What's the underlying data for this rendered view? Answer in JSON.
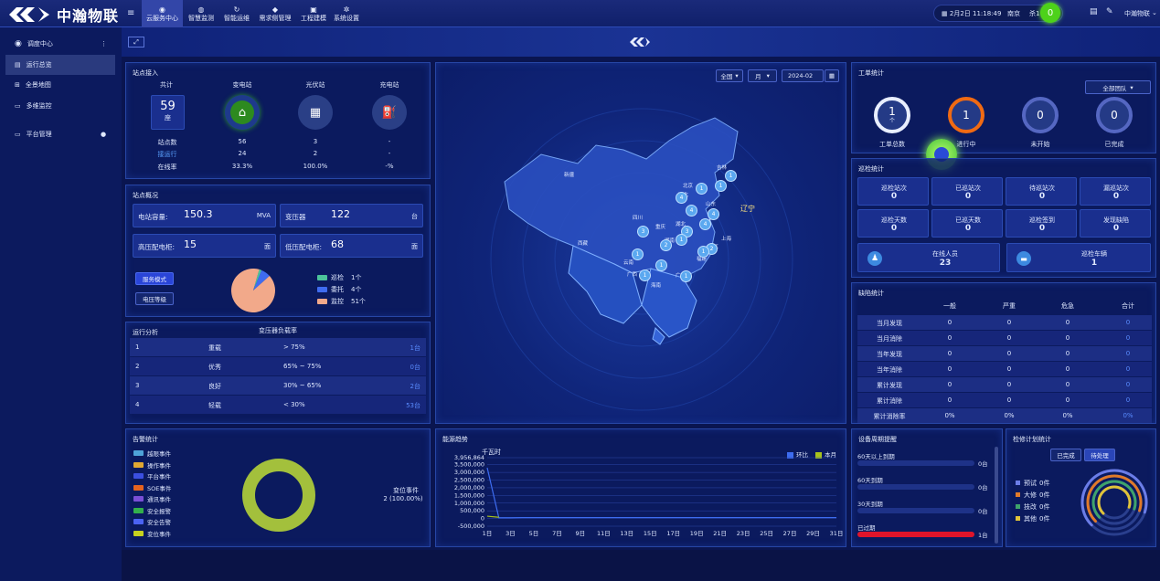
{
  "brand": {
    "name": "中瀚物联"
  },
  "nav": {
    "tabs": [
      {
        "label": "云服务中心",
        "icon": "◉"
      },
      {
        "label": "智慧监测",
        "icon": "◍"
      },
      {
        "label": "智能运维",
        "icon": "↻"
      },
      {
        "label": "需求侧管理",
        "icon": "◆"
      },
      {
        "label": "工程建模",
        "icon": "▣"
      },
      {
        "label": "系统设置",
        "icon": "✲"
      }
    ],
    "datetime": "2月2日 11:18:49",
    "city": "南京",
    "weather_prefix": "杀1",
    "notif_count": "0",
    "user": "中瀚物联"
  },
  "sidebar": {
    "items": [
      {
        "label": "调度中心"
      },
      {
        "label": "运行总览"
      },
      {
        "label": "全景地图"
      },
      {
        "label": "多维监控"
      },
      {
        "label": "平台管理"
      }
    ]
  },
  "station_access": {
    "title": "站点接入",
    "total_label": "共计",
    "total_value": "59",
    "total_unit": "座",
    "cols": [
      "变电站",
      "光伏站",
      "充电站"
    ],
    "rows": [
      {
        "label": "站点数",
        "values": [
          "56",
          "3",
          "-"
        ]
      },
      {
        "label": "接运行",
        "values": [
          "24",
          "2",
          "-"
        ]
      },
      {
        "label": "在线率",
        "values": [
          "33.3%",
          "100.0%",
          "-%"
        ]
      }
    ]
  },
  "station_overview": {
    "title": "站点概况",
    "cards": [
      {
        "label": "电站容量:",
        "value": "150.3",
        "unit": "MVA"
      },
      {
        "label": "变压器",
        "value": "122",
        "unit": "台"
      },
      {
        "label": "高压配电柜:",
        "value": "15",
        "unit": "面"
      },
      {
        "label": "低压配电柜:",
        "value": "68",
        "unit": "面"
      }
    ],
    "btn_service": "服务模式",
    "btn_voltage": "电压等级",
    "pie": [
      {
        "name": "巡检",
        "count": "1个",
        "value": 1,
        "color": "#4cc39a"
      },
      {
        "name": "委托",
        "count": "4个",
        "value": 4,
        "color": "#3f6cf0"
      },
      {
        "name": "监控",
        "count": "51个",
        "value": 51,
        "color": "#f2a98a"
      }
    ]
  },
  "run_analysis": {
    "title": "运行分析",
    "subtitle": "变压器负载率",
    "rows": [
      {
        "idx": "1",
        "name": "重载",
        "range": "> 75%",
        "count": "1台"
      },
      {
        "idx": "2",
        "name": "优秀",
        "range": "65% ~ 75%",
        "count": "0台"
      },
      {
        "idx": "3",
        "name": "良好",
        "range": "30% ~ 65%",
        "count": "2台"
      },
      {
        "idx": "4",
        "name": "轻载",
        "range": "< 30%",
        "count": "53台"
      }
    ]
  },
  "map": {
    "filter_region": "全国",
    "filter_period": "月",
    "filter_date": "2024-02",
    "highlight": "辽宁",
    "labels": [
      "新疆",
      "西藏",
      "广西",
      "海南",
      "云南",
      "吉林",
      "北京",
      "河北",
      "山东",
      "江苏",
      "上海",
      "浙江",
      "福建",
      "广东",
      "湖南",
      "湖北",
      "四川",
      "重庆"
    ],
    "clusters": [
      "1",
      "1",
      "4",
      "4",
      "4",
      "4",
      "3",
      "3",
      "2",
      "2",
      "1",
      "1",
      "1",
      "1",
      "1",
      "1",
      "1"
    ]
  },
  "work_orders": {
    "title": "工单统计",
    "filter": "全部团队",
    "items": [
      {
        "label": "工单总数",
        "value": "1",
        "sub": "个",
        "color": "#e8eeff"
      },
      {
        "label": "进行中",
        "value": "1",
        "sub": "",
        "color": "#f06a13"
      },
      {
        "label": "未开始",
        "value": "0",
        "sub": "",
        "color": "#5567c2"
      },
      {
        "label": "已完成",
        "value": "0",
        "sub": "",
        "color": "#5567c2"
      }
    ]
  },
  "patrol": {
    "title": "巡检统计",
    "cells": [
      {
        "label": "巡检站次",
        "value": "0"
      },
      {
        "label": "已巡站次",
        "value": "0"
      },
      {
        "label": "待巡站次",
        "value": "0"
      },
      {
        "label": "漏巡站次",
        "value": "0"
      },
      {
        "label": "巡检天数",
        "value": "0"
      },
      {
        "label": "已巡天数",
        "value": "0"
      },
      {
        "label": "巡检签到",
        "value": "0"
      },
      {
        "label": "发现缺陷",
        "value": "0"
      }
    ],
    "online_label": "在线人员",
    "online_value": "23",
    "vehicle_label": "巡检车辆",
    "vehicle_value": "1"
  },
  "defects": {
    "title": "缺陷统计",
    "headers": [
      "一般",
      "严重",
      "危急",
      "合计"
    ],
    "rows": [
      {
        "label": "当月发现",
        "values": [
          "0",
          "0",
          "0",
          "0"
        ]
      },
      {
        "label": "当月消除",
        "values": [
          "0",
          "0",
          "0",
          "0"
        ]
      },
      {
        "label": "当年发现",
        "values": [
          "0",
          "0",
          "0",
          "0"
        ]
      },
      {
        "label": "当年消除",
        "values": [
          "0",
          "0",
          "0",
          "0"
        ]
      },
      {
        "label": "累计发现",
        "values": [
          "0",
          "0",
          "0",
          "0"
        ]
      },
      {
        "label": "累计消除",
        "values": [
          "0",
          "0",
          "0",
          "0"
        ]
      },
      {
        "label": "累计消除率",
        "values": [
          "0%",
          "0%",
          "0%",
          "0%"
        ]
      }
    ]
  },
  "alarms": {
    "title": "告警统计",
    "legend": [
      {
        "name": "越限事件",
        "color": "#4ea3d8"
      },
      {
        "name": "操作事件",
        "color": "#e1a832"
      },
      {
        "name": "平台事件",
        "color": "#3b4fe0"
      },
      {
        "name": "SOE事件",
        "color": "#e5631f"
      },
      {
        "name": "通讯事件",
        "color": "#7a4fd6"
      },
      {
        "name": "安全报警",
        "color": "#33b04c"
      },
      {
        "name": "安全告警",
        "color": "#4b63f2"
      },
      {
        "name": "变位事件",
        "color": "#c6d11f"
      }
    ],
    "summary_label": "变位事件",
    "summary_value": "2 (100.00%)",
    "ring_color": "#a3c03c"
  },
  "energy": {
    "title": "能源趋势",
    "unit": "千瓦时",
    "legend": [
      {
        "name": "环比",
        "color": "#3d6cf0"
      },
      {
        "name": "本月",
        "color": "#a8c21c"
      }
    ]
  },
  "chart_data": {
    "type": "line",
    "ylabel": "千瓦时",
    "ylim": [
      -500000,
      3956864
    ],
    "yticks": [
      "3,956,864",
      "3,500,000",
      "3,000,000",
      "2,500,000",
      "2,000,000",
      "1,500,000",
      "1,000,000",
      "500,000",
      "0",
      "-500,000"
    ],
    "ytick_values": [
      3956864,
      3500000,
      3000000,
      2500000,
      2000000,
      1500000,
      1000000,
      500000,
      0,
      -500000
    ],
    "categories": [
      "1日",
      "3日",
      "5日",
      "7日",
      "9日",
      "11日",
      "13日",
      "15日",
      "17日",
      "19日",
      "21日",
      "23日",
      "25日",
      "27日",
      "29日",
      "31日"
    ],
    "x": [
      1,
      2,
      3,
      4,
      5,
      6,
      7,
      8,
      9,
      10,
      11,
      12,
      13,
      14,
      15,
      16,
      17,
      18,
      19,
      20,
      21,
      22,
      23,
      24,
      25,
      26,
      27,
      28,
      29,
      30,
      31
    ],
    "series": [
      {
        "name": "环比",
        "color": "#3d6cf0",
        "values": [
          3300000,
          50000,
          50000,
          60000,
          60000,
          60000,
          60000,
          60000,
          60000,
          60000,
          60000,
          60000,
          60000,
          60000,
          60000,
          60000,
          60000,
          60000,
          60000,
          60000,
          60000,
          60000,
          60000,
          60000,
          60000,
          60000,
          60000,
          60000,
          60000,
          60000,
          60000
        ]
      },
      {
        "name": "本月",
        "color": "#a8c21c",
        "values": [
          150000,
          80000
        ]
      }
    ]
  },
  "expiry": {
    "title": "设备周期提醒",
    "rows": [
      {
        "label": "60天以上到期",
        "count": "0台",
        "fill": 0
      },
      {
        "label": "60天到期",
        "count": "0台",
        "fill": 0
      },
      {
        "label": "30天到期",
        "count": "0台",
        "fill": 0
      },
      {
        "label": "已过期",
        "count": "1台",
        "fill": 1
      }
    ]
  },
  "maintenance": {
    "title": "检修计划统计",
    "tab_done": "已完成",
    "tab_pending": "待处理",
    "legend": [
      {
        "name": "预试",
        "count": "0件",
        "color": "#6b7de8"
      },
      {
        "name": "大修",
        "count": "0件",
        "color": "#e07a2a"
      },
      {
        "name": "技改",
        "count": "0件",
        "color": "#3ea36b"
      },
      {
        "name": "其他",
        "count": "0件",
        "color": "#e0c33a"
      }
    ]
  }
}
